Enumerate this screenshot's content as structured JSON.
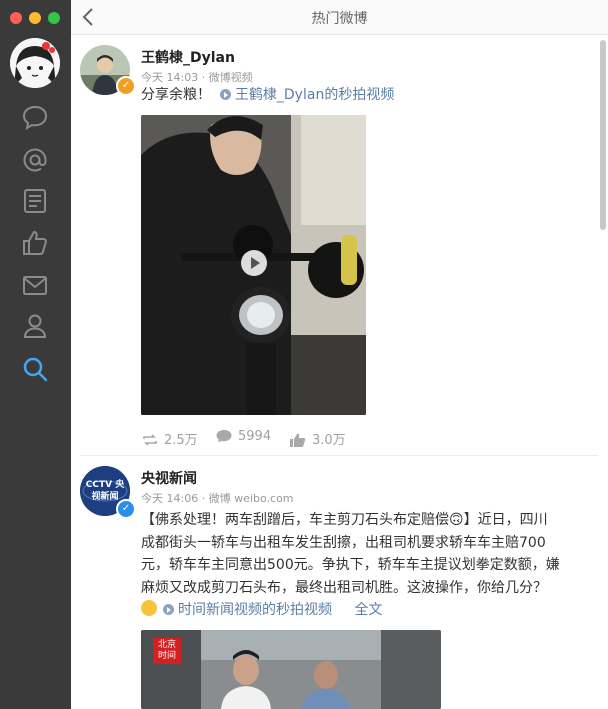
{
  "window": {
    "title": "热门微博"
  },
  "sidebar": {
    "items": [
      {
        "name": "comment-icon"
      },
      {
        "name": "mention-icon"
      },
      {
        "name": "document-icon"
      },
      {
        "name": "thumbs-up-icon"
      },
      {
        "name": "mail-icon"
      },
      {
        "name": "profile-icon"
      },
      {
        "name": "search-icon",
        "active": true
      }
    ]
  },
  "posts": [
    {
      "author": "王鹤棣_Dylan",
      "meta": "今天 14:03 · 微博视频",
      "text": "分享余粮！",
      "video_link": "王鹤棣_Dylan的秒拍视频",
      "reposts": "2.5万",
      "comments": "5994",
      "likes": "3.0万"
    },
    {
      "author": "央视新闻",
      "meta": "今天 14:06 · 微博 weibo.com",
      "avatar_text": "CCTV 央视新闻",
      "text_lines": [
        "【佛系处理！两车刮蹭后，车主剪刀石头布定赔偿🙃】近日，四川",
        "成都街头一轿车与出租车发生刮擦，出租司机要求轿车车主赔700",
        "元，轿车车主同意出500元。争执下，轿车车主提议划拳定数额，嫌",
        "麻烦又改成剪刀石头布，最终出租司机胜。这波操作，你给几分？"
      ],
      "video_link": "时间新闻视频的秒拍视频",
      "full_text": "全文",
      "video_badge": "北京时间"
    }
  ],
  "colors": {
    "sidebar": "#3a3a3b",
    "accent": "#5b7ea8",
    "search_active": "#3fa9f5",
    "verified_orange": "#f0a020",
    "verified_blue": "#2b8ee8"
  }
}
